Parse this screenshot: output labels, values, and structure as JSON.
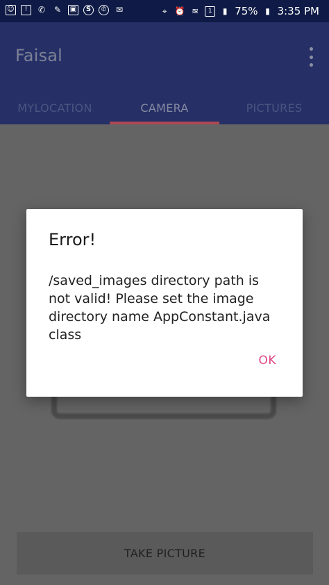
{
  "status_bar": {
    "battery": "75%",
    "time": "3:35 PM",
    "left_icons": [
      "messenger-icon",
      "alert-icon",
      "call-missed-icon",
      "cleaning-icon",
      "photo-icon",
      "skype-icon",
      "whatsapp-icon",
      "mail-icon"
    ],
    "right_icons": [
      "location-icon",
      "alarm-icon",
      "wifi-icon",
      "sim-icon",
      "signal-icon",
      "battery-icon"
    ]
  },
  "app_bar": {
    "title": "Faisal",
    "tabs": [
      {
        "label": "MYLOCATION",
        "active": false
      },
      {
        "label": "CAMERA",
        "active": true
      },
      {
        "label": "PICTURES",
        "active": false
      }
    ]
  },
  "main": {
    "take_picture_label": "TAKE PICTURE"
  },
  "dialog": {
    "title": "Error!",
    "message": "/saved_images directory path is not valid! Please set the image directory name AppConstant.java class",
    "ok_label": "OK"
  },
  "colors": {
    "status_bar": "#0f1b46",
    "app_bar": "#263067",
    "accent": "#e04888",
    "tab_indicator": "#c64c4c",
    "scrim": "#646464"
  }
}
